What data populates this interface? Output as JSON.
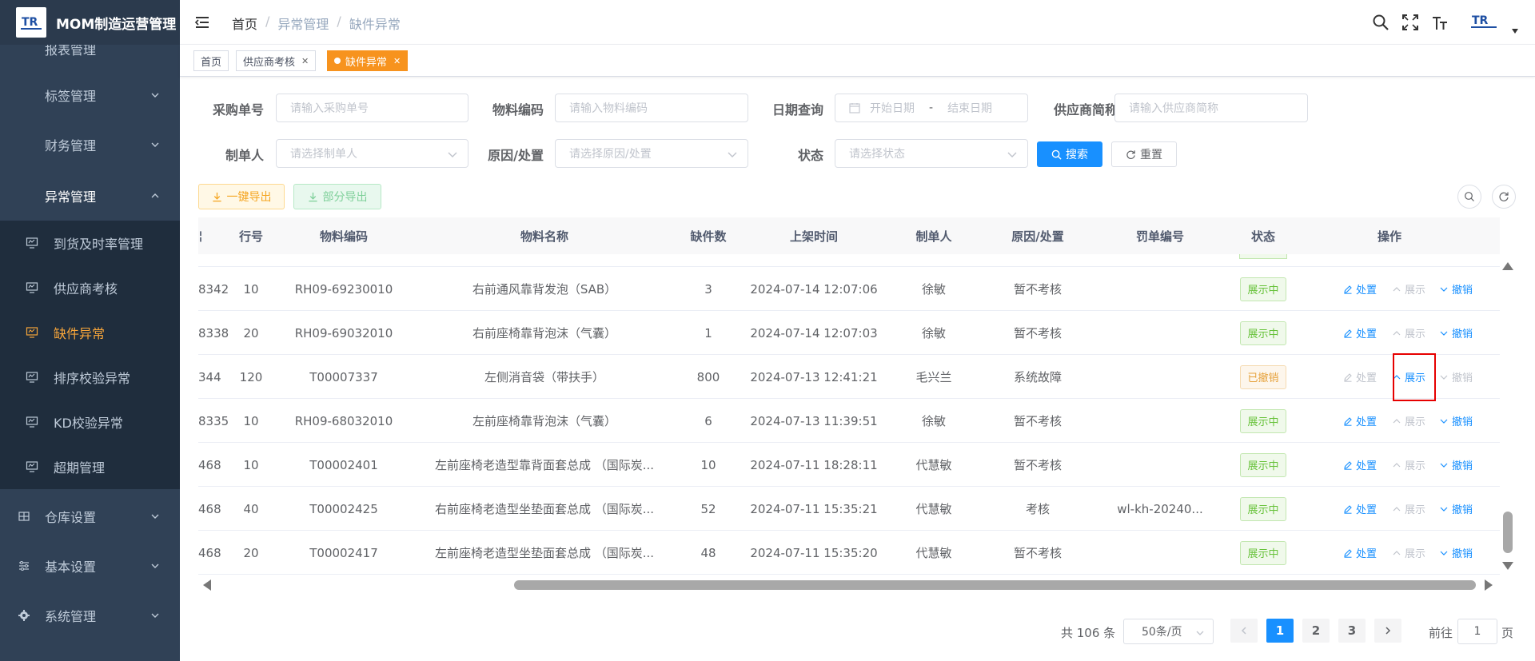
{
  "app": {
    "title": "MOM制造运营管理",
    "logo_text": "TR"
  },
  "sidebar": {
    "top_partial": "报表管理",
    "items": [
      {
        "label": "标签管理"
      },
      {
        "label": "财务管理"
      },
      {
        "label": "异常管理"
      }
    ],
    "sub_items": [
      {
        "label": "到货及时率管理"
      },
      {
        "label": "供应商考核"
      },
      {
        "label": "缺件异常"
      },
      {
        "label": "排序校验异常"
      },
      {
        "label": "KD校验异常"
      },
      {
        "label": "超期管理"
      }
    ],
    "groups": [
      {
        "label": "仓库设置"
      },
      {
        "label": "基本设置"
      },
      {
        "label": "系统管理"
      }
    ]
  },
  "breadcrumb": [
    "首页",
    "异常管理",
    "缺件异常"
  ],
  "tags": [
    {
      "label": "首页"
    },
    {
      "label": "供应商考核"
    },
    {
      "label": "缺件异常"
    }
  ],
  "filters": {
    "purchase_no": {
      "label": "采购单号",
      "placeholder": "请输入采购单号"
    },
    "material_code": {
      "label": "物料编码",
      "placeholder": "请输入物料编码"
    },
    "date": {
      "label": "日期查询",
      "start": "开始日期",
      "sep": "-",
      "end": "结束日期"
    },
    "supplier": {
      "label": "供应商简称",
      "placeholder": "请输入供应商简称"
    },
    "creator": {
      "label": "制单人",
      "placeholder": "请选择制单人"
    },
    "reason": {
      "label": "原因/处置",
      "placeholder": "请选择原因/处置"
    },
    "status": {
      "label": "状态",
      "placeholder": "请选择状态"
    },
    "search_btn": "搜索",
    "reset_btn": "重置"
  },
  "toolbar": {
    "export_all": "一键导出",
    "export_part": "部分导出"
  },
  "table": {
    "headers": [
      "行号",
      "物料编码",
      "物料名称",
      "缺件数",
      "上架时间",
      "制单人",
      "原因/处置",
      "罚单编号",
      "状态",
      "操作"
    ],
    "rows": [
      {
        "c0": "8342",
        "line": "10",
        "code": "RH09-69230010",
        "name": "右前通风靠背发泡（SAB）",
        "qty": "3",
        "time": "2024-07-14 12:07:06",
        "creator": "徐敏",
        "reason": "暂不考核",
        "ticket": "",
        "status": "展示中",
        "status_type": "green"
      },
      {
        "c0": "8338",
        "line": "20",
        "code": "RH09-69032010",
        "name": "右前座椅靠背泡沫（气囊）",
        "qty": "1",
        "time": "2024-07-14 12:07:03",
        "creator": "徐敏",
        "reason": "暂不考核",
        "ticket": "",
        "status": "展示中",
        "status_type": "green"
      },
      {
        "c0": "344",
        "line": "120",
        "code": "T00007337",
        "name": "左侧消音袋（带扶手）",
        "qty": "800",
        "time": "2024-07-13 12:41:21",
        "creator": "毛兴兰",
        "reason": "系统故障",
        "ticket": "",
        "status": "已撤销",
        "status_type": "orange"
      },
      {
        "c0": "8335",
        "line": "10",
        "code": "RH09-68032010",
        "name": "左前座椅靠背泡沫（气囊）",
        "qty": "6",
        "time": "2024-07-13 11:39:51",
        "creator": "徐敏",
        "reason": "暂不考核",
        "ticket": "",
        "status": "展示中",
        "status_type": "green"
      },
      {
        "c0": "468",
        "line": "10",
        "code": "T00002401",
        "name": "左前座椅老造型靠背面套总成 （国际炭...",
        "qty": "10",
        "time": "2024-07-11 18:28:11",
        "creator": "代慧敏",
        "reason": "暂不考核",
        "ticket": "",
        "status": "展示中",
        "status_type": "green"
      },
      {
        "c0": "468",
        "line": "40",
        "code": "T00002425",
        "name": "右前座椅老造型坐垫面套总成 （国际炭...",
        "qty": "52",
        "time": "2024-07-11 15:35:21",
        "creator": "代慧敏",
        "reason": "考核",
        "ticket": "wl-kh-20240...",
        "status": "展示中",
        "status_type": "green"
      },
      {
        "c0": "468",
        "line": "20",
        "code": "T00002417",
        "name": "左前座椅老造型坐垫面套总成 （国际炭...",
        "qty": "48",
        "time": "2024-07-11 15:35:20",
        "creator": "代慧敏",
        "reason": "暂不考核",
        "ticket": "",
        "status": "展示中",
        "status_type": "green"
      }
    ],
    "ops": {
      "handle": "处置",
      "show": "展示",
      "revoke": "撤销"
    }
  },
  "pagination": {
    "total": "共 106 条",
    "page_size": "50条/页",
    "pages": [
      "1",
      "2",
      "3"
    ],
    "current": "1",
    "goto_prefix": "前往",
    "goto_value": "1",
    "goto_suffix": "页"
  }
}
